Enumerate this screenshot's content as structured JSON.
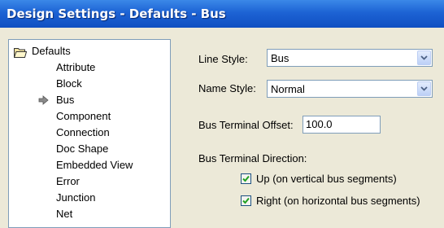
{
  "window": {
    "title": "Design Settings - Defaults - Bus"
  },
  "tree": {
    "root_label": "Defaults",
    "root_icon": "folder-open-icon",
    "selected_marker_icon": "arrow-pointer-icon",
    "items": [
      {
        "label": "Attribute",
        "selected": false
      },
      {
        "label": "Block",
        "selected": false
      },
      {
        "label": "Bus",
        "selected": true
      },
      {
        "label": "Component",
        "selected": false
      },
      {
        "label": "Connection",
        "selected": false
      },
      {
        "label": "Doc Shape",
        "selected": false
      },
      {
        "label": "Embedded View",
        "selected": false
      },
      {
        "label": "Error",
        "selected": false
      },
      {
        "label": "Junction",
        "selected": false
      },
      {
        "label": "Net",
        "selected": false
      }
    ]
  },
  "settings": {
    "line_style": {
      "label": "Line Style:",
      "value": "Bus"
    },
    "name_style": {
      "label": "Name Style:",
      "value": "Normal"
    },
    "terminal_offset": {
      "label": "Bus Terminal Offset:",
      "value": "100.0"
    },
    "terminal_direction": {
      "label": "Bus Terminal Direction:",
      "options": [
        {
          "label": "Up  (on vertical bus segments)",
          "checked": true
        },
        {
          "label": "Right  (on horizontal bus segments)",
          "checked": true
        }
      ]
    }
  },
  "colors": {
    "titlebar": "#1d63d4",
    "dialog_bg": "#ece9d8",
    "checkmark": "#21a121"
  }
}
